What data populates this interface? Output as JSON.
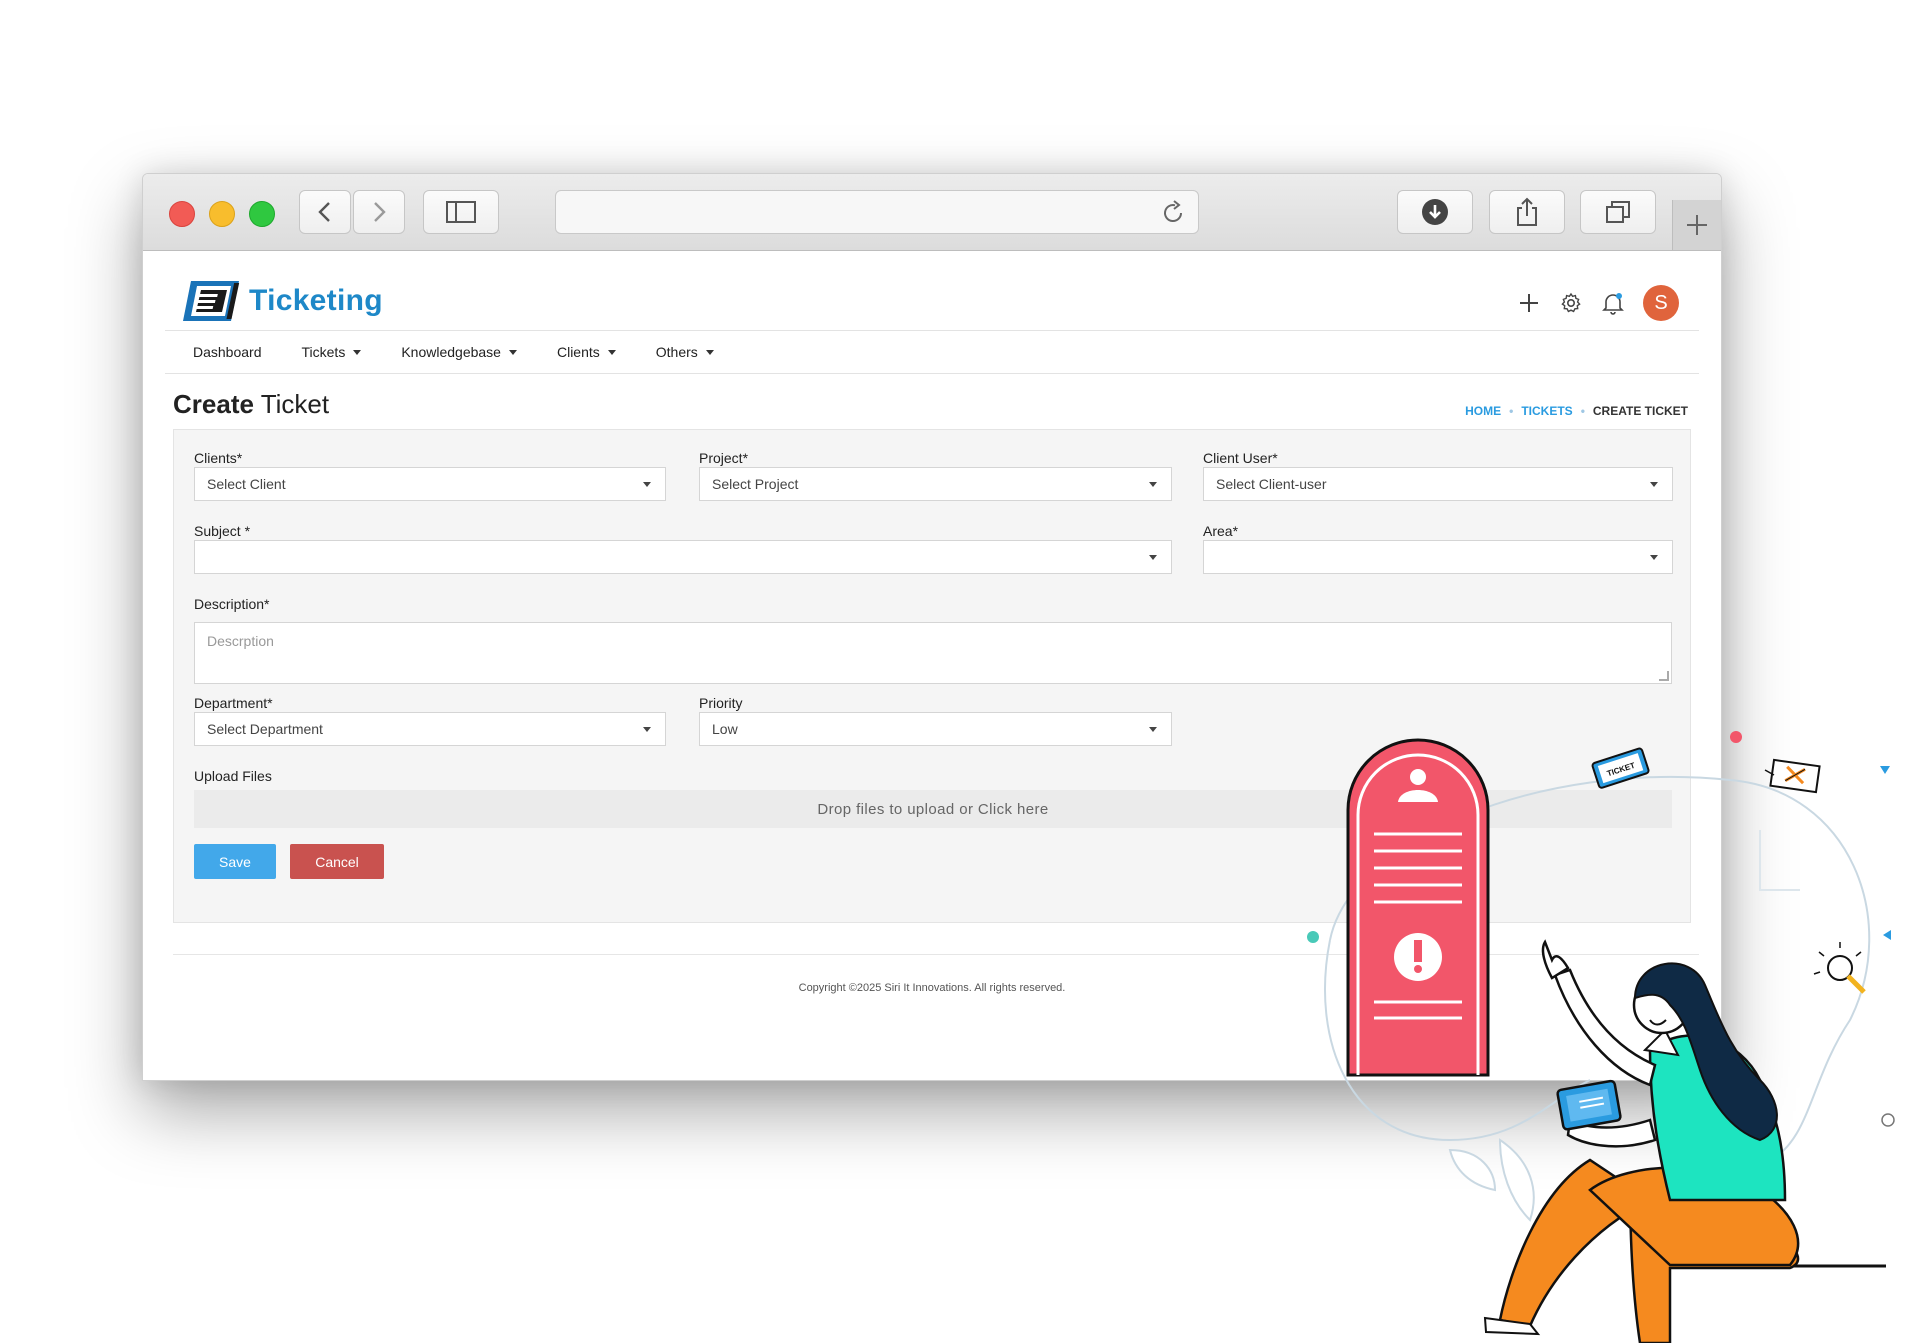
{
  "app": {
    "logo_text": "Ticketing",
    "avatar_initial": "S"
  },
  "nav": {
    "items": [
      {
        "label": "Dashboard"
      },
      {
        "label": "Tickets"
      },
      {
        "label": "Knowledgebase"
      },
      {
        "label": "Clients"
      },
      {
        "label": "Others"
      }
    ]
  },
  "page": {
    "title_bold": "Create",
    "title_rest": " Ticket",
    "breadcrumb": [
      "HOME",
      "TICKETS",
      "CREATE TICKET"
    ]
  },
  "form": {
    "clients": {
      "label": "Clients*",
      "value": "Select Client"
    },
    "project": {
      "label": "Project*",
      "value": "Select Project"
    },
    "client_user": {
      "label": "Client User*",
      "value": "Select Client-user"
    },
    "subject": {
      "label": "Subject *",
      "value": ""
    },
    "area": {
      "label": "Area*",
      "value": ""
    },
    "description": {
      "label": "Description*",
      "placeholder": "Descrption"
    },
    "department": {
      "label": "Department*",
      "value": "Select Department"
    },
    "priority": {
      "label": "Priority",
      "value": "Low"
    },
    "upload": {
      "label": "Upload Files",
      "drop_text": "Drop files to upload or Click here"
    },
    "save_label": "Save",
    "cancel_label": "Cancel"
  },
  "footer": {
    "copyright": "Copyright ©2025 Siri It Innovations. All rights reserved."
  },
  "illustration": {
    "ticket_tag_text": "TICKET"
  },
  "colors": {
    "brand": "#1e88c8",
    "save": "#42a8ea",
    "cancel": "#c9524f",
    "avatar": "#e0643c",
    "phone": "#f2566a",
    "shirt": "#1de4c0",
    "pants": "#f58a1f"
  }
}
